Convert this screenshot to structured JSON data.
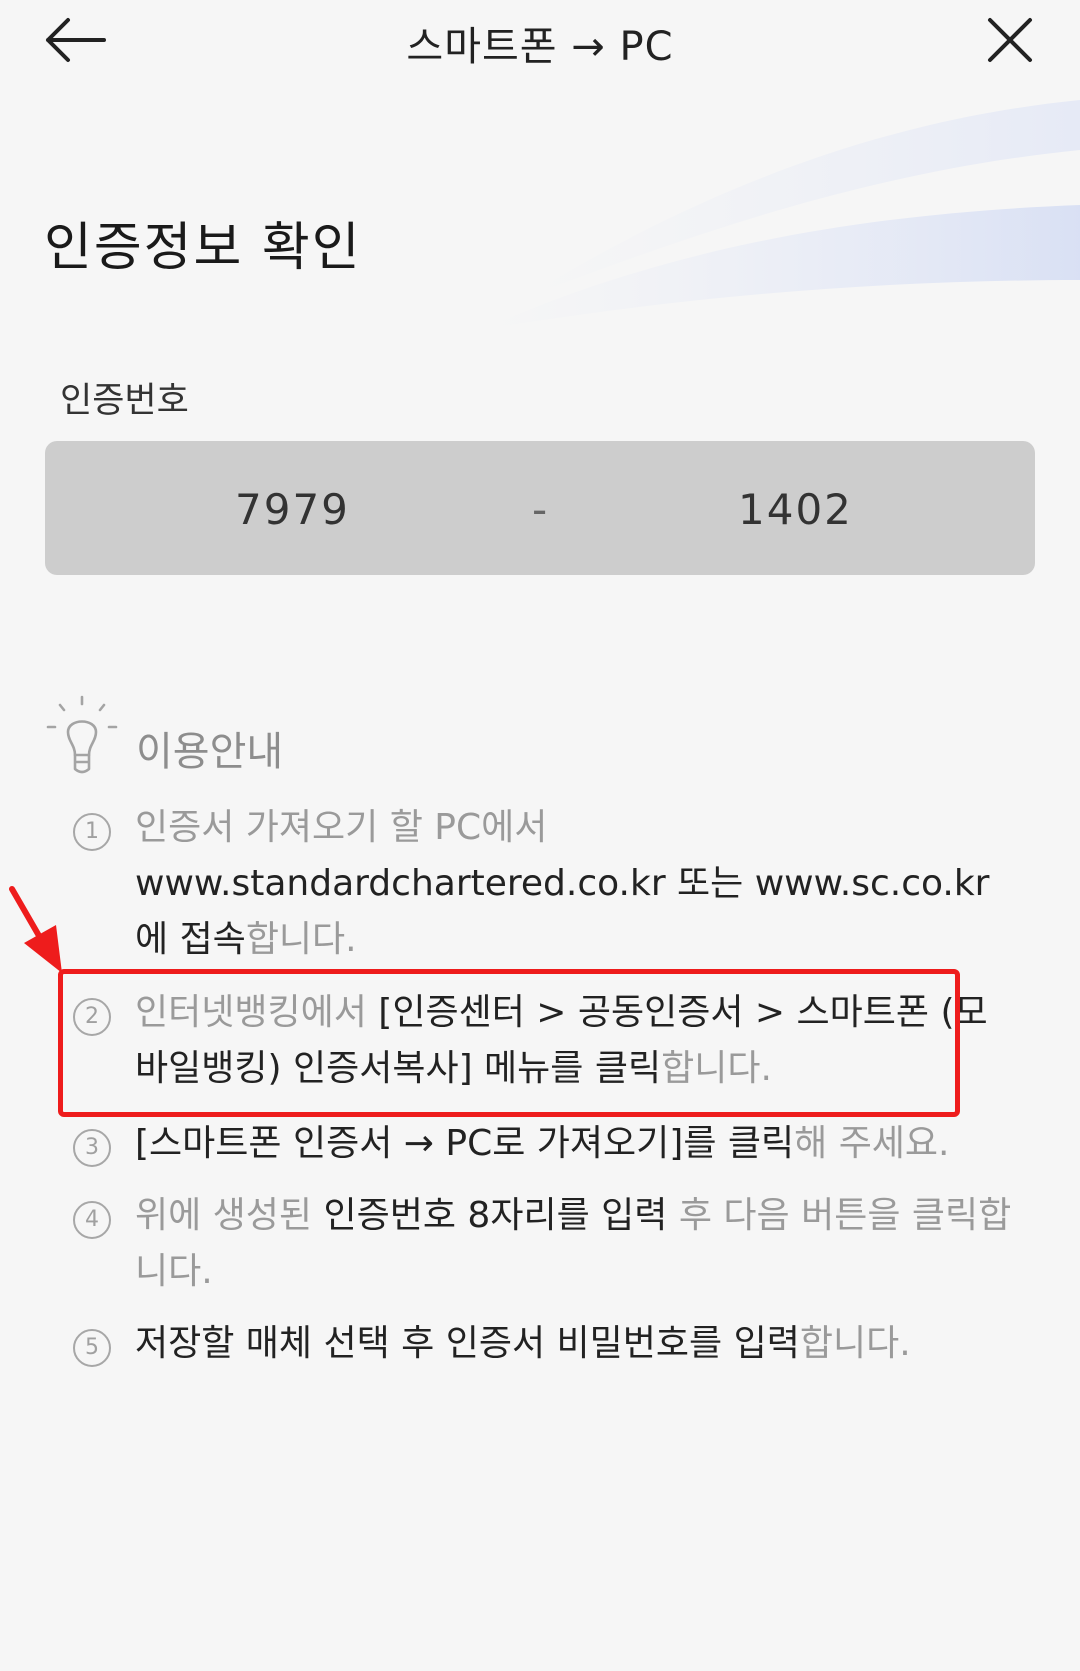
{
  "header": {
    "title": "스마트폰 → PC",
    "back_icon": "arrow-left-icon",
    "close_icon": "close-icon"
  },
  "page_title": "인증정보 확인",
  "auth_code": {
    "label": "인증번호",
    "first": "7979",
    "separator": "-",
    "second": "1402"
  },
  "guide": {
    "title": "이용안내",
    "icon": "lightbulb-icon",
    "steps": [
      {
        "num": "1",
        "muted1": "인증서 가져오기 할 PC에서",
        "main": "www.standardchartered.co.kr 또는 www.sc.co.kr에 접속",
        "muted2": "합니다."
      },
      {
        "num": "2",
        "muted1": "인터넷뱅킹에서",
        "main": "[인증센터 > 공동인증서 > 스마트폰 (모바일뱅킹) 인증서복사] 메뉴를 클릭",
        "muted2": "합니다."
      },
      {
        "num": "3",
        "muted1": "",
        "main": "[스마트폰 인증서 → PC로 가져오기]를 클릭",
        "muted2": "해 주세요."
      },
      {
        "num": "4",
        "muted1": "위에 생성된",
        "main": "인증번호 8자리를 입력",
        "muted2": "후 다음 버튼을 클릭합니다."
      },
      {
        "num": "5",
        "muted1": "",
        "main": "저장할 매체 선택 후 인증서 비밀번호를 입력",
        "muted2": "합니다."
      }
    ]
  },
  "colors": {
    "background": "#f6f6f6",
    "code_box": "#cdcdcd",
    "highlight": "#ee1c1c",
    "muted_text": "#9a9a9a"
  }
}
